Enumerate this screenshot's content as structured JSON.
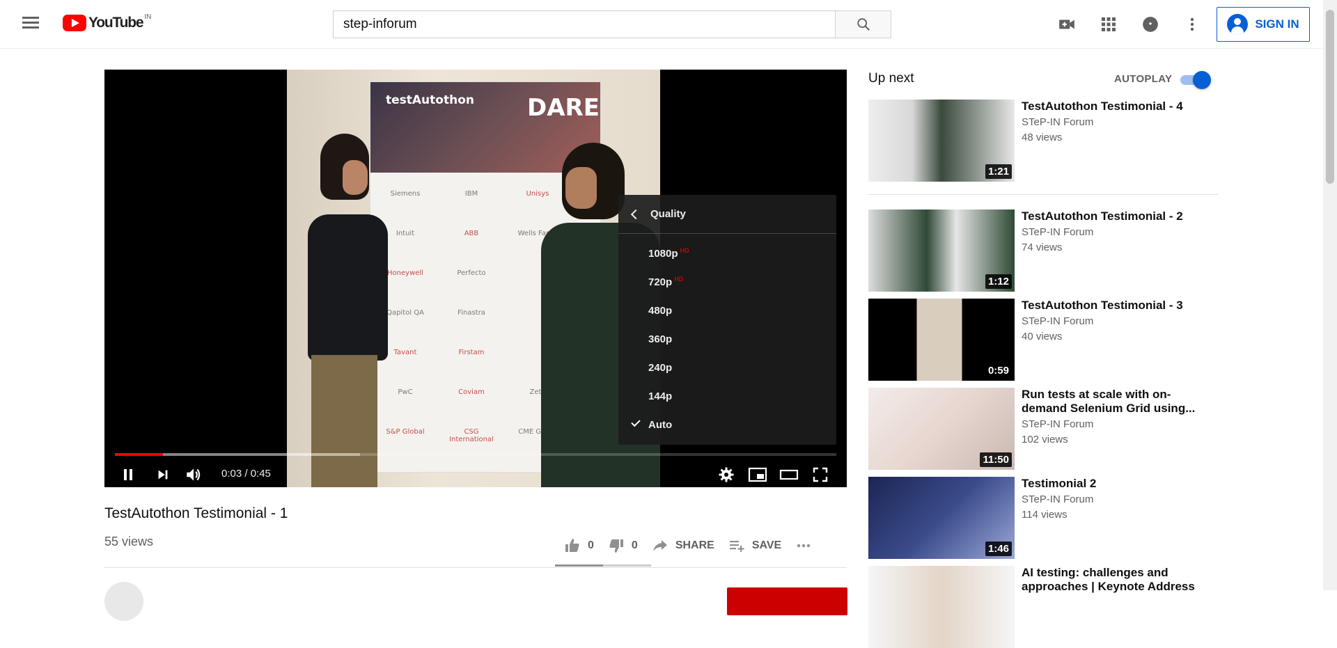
{
  "masthead": {
    "logo_text": "YouTube",
    "country": "IN",
    "search_value": "step-inforum",
    "signin_label": "SIGN IN"
  },
  "player": {
    "time_current": "0:03",
    "time_total": "0:45",
    "time_display": "0:03 / 0:45",
    "progress_fraction": 0.067,
    "buffered_fraction": 0.34,
    "banner_brand": "testAutothon",
    "banner_slogan": "DARE",
    "banner_sponsors": [
      {
        "name": "Siemens",
        "red": false
      },
      {
        "name": "IBM",
        "red": false
      },
      {
        "name": "Unisys",
        "red": true
      },
      {
        "name": "Intuit",
        "red": false
      },
      {
        "name": "ABB",
        "red": true
      },
      {
        "name": "Wells Fargo",
        "red": false
      },
      {
        "name": "Honeywell",
        "red": true
      },
      {
        "name": "Perfecto",
        "red": false
      },
      {
        "name": "",
        "red": false
      },
      {
        "name": "Qapitol QA",
        "red": false
      },
      {
        "name": "Finastra",
        "red": false
      },
      {
        "name": "",
        "red": false
      },
      {
        "name": "Tavant",
        "red": true
      },
      {
        "name": "Firstam",
        "red": true
      },
      {
        "name": "",
        "red": false
      },
      {
        "name": "PwC",
        "red": false
      },
      {
        "name": "Coviam",
        "red": true
      },
      {
        "name": "Zeta",
        "red": false
      },
      {
        "name": "S&P Global",
        "red": true
      },
      {
        "name": "CSG International",
        "red": true
      },
      {
        "name": "CME Group",
        "red": false
      }
    ],
    "quality_menu": {
      "header": "Quality",
      "options": [
        {
          "label": "1080p",
          "badge": "HD",
          "selected": false
        },
        {
          "label": "720p",
          "badge": "HD",
          "selected": false
        },
        {
          "label": "480p",
          "badge": "",
          "selected": false
        },
        {
          "label": "360p",
          "badge": "",
          "selected": false
        },
        {
          "label": "240p",
          "badge": "",
          "selected": false
        },
        {
          "label": "144p",
          "badge": "",
          "selected": false
        },
        {
          "label": "Auto",
          "badge": "",
          "selected": true
        }
      ]
    }
  },
  "video": {
    "title": "TestAutothon Testimonial - 1",
    "views": "55 views",
    "like_count": "0",
    "dislike_count": "0",
    "share_label": "SHARE",
    "save_label": "SAVE",
    "like_ratio": 0.5
  },
  "sidebar": {
    "upnext_label": "Up next",
    "autoplay_label": "AUTOPLAY",
    "autoplay_on": true,
    "items": [
      {
        "title": "TestAutothon Testimonial - 4",
        "channel": "STeP-IN Forum",
        "views": "48 views",
        "duration": "1:21"
      },
      {
        "title": "TestAutothon Testimonial - 2",
        "channel": "STeP-IN Forum",
        "views": "74 views",
        "duration": "1:12"
      },
      {
        "title": "TestAutothon Testimonial - 3",
        "channel": "STeP-IN Forum",
        "views": "40 views",
        "duration": "0:59"
      },
      {
        "title": "Run tests at scale with on-demand Selenium Grid using...",
        "channel": "STeP-IN Forum",
        "views": "102 views",
        "duration": "11:50"
      },
      {
        "title": "Testimonial 2",
        "channel": "STeP-IN Forum",
        "views": "114 views",
        "duration": "1:46"
      },
      {
        "title": "AI testing: challenges and approaches | Keynote Address",
        "channel": "",
        "views": "",
        "duration": ""
      }
    ]
  },
  "colors": {
    "brand_red": "#ff0000",
    "link_blue": "#065fd4",
    "text_secondary": "#606060"
  },
  "icons": [
    "menu-icon",
    "youtube-logo-icon",
    "search-icon",
    "create-video-icon",
    "apps-icon",
    "messages-icon",
    "more-vert-icon",
    "account-circle-icon",
    "pause-icon",
    "next-icon",
    "volume-icon",
    "settings-icon",
    "miniplayer-icon",
    "theater-icon",
    "fullscreen-icon",
    "thumb-up-icon",
    "thumb-down-icon",
    "share-icon",
    "save-playlist-icon",
    "more-horiz-icon"
  ]
}
